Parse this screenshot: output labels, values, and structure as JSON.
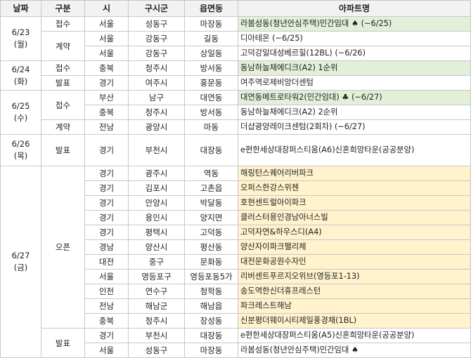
{
  "headers": {
    "date": "날짜",
    "type": "구분",
    "city": "시",
    "district": "구시군",
    "town": "읍면동",
    "apartment": "아파트명"
  },
  "dates": {
    "d0623": {
      "day": "6/23",
      "weekday": "(월)"
    },
    "d0624": {
      "day": "6/24",
      "weekday": "(화)"
    },
    "d0625": {
      "day": "6/25",
      "weekday": "(수)"
    },
    "d0626": {
      "day": "6/26",
      "weekday": "(목)"
    },
    "d0627": {
      "day": "6/27",
      "weekday": "(금)"
    }
  },
  "types": {
    "r0": "접수",
    "r1": "계약",
    "r3": "접수",
    "r4": "발표",
    "r5": "접수",
    "r7": "계약",
    "r8": "발표",
    "r9": "오픈",
    "r20": "발표"
  },
  "rows": [
    {
      "city": "서울",
      "district": "성동구",
      "town": "마장동",
      "apartment": "라봄성동(청년안심주택)민간임대 ♠ (~6/25)",
      "bg": "green"
    },
    {
      "city": "서울",
      "district": "강동구",
      "town": "길동",
      "apartment": "디아테온 (~6/25)",
      "bg": "none"
    },
    {
      "city": "서울",
      "district": "강동구",
      "town": "상일동",
      "apartment": "고덕강일대성베르힐(12BL) (~6/26)",
      "bg": "none"
    },
    {
      "city": "충북",
      "district": "청주시",
      "town": "방서동",
      "apartment": "동남하늘채에디크(A2) 1순위",
      "bg": "green"
    },
    {
      "city": "경기",
      "district": "여주시",
      "town": "홍문동",
      "apartment": "여주역로제비앙더센텀",
      "bg": "none"
    },
    {
      "city": "부산",
      "district": "남구",
      "town": "대연동",
      "apartment": "대연동메트로타워2(민간임대) ♣ (~6/27)",
      "bg": "green"
    },
    {
      "city": "충북",
      "district": "청주시",
      "town": "방서동",
      "apartment": "동남하늘채에디크(A2) 2순위",
      "bg": "none"
    },
    {
      "city": "전남",
      "district": "광양시",
      "town": "마동",
      "apartment": "더샵광양레이크센텀(2회차) (~6/27)",
      "bg": "none"
    },
    {
      "city": "경기",
      "district": "부천시",
      "town": "대장동",
      "apartment": "e편한세상대장퍼스티움(A6)신혼희망타운(공공분양)",
      "bg": "none"
    },
    {
      "city": "경기",
      "district": "광주시",
      "town": "역동",
      "apartment": "해링턴스퀘어리버파크",
      "bg": "yellow"
    },
    {
      "city": "경기",
      "district": "김포시",
      "town": "고촌읍",
      "apartment": "오퍼스한강스위첸",
      "bg": "yellow"
    },
    {
      "city": "경기",
      "district": "안양시",
      "town": "박달동",
      "apartment": "호현센트럴아이파크",
      "bg": "yellow"
    },
    {
      "city": "경기",
      "district": "용인시",
      "town": "양지면",
      "apartment": "클러스터용인경남아너스빌",
      "bg": "yellow"
    },
    {
      "city": "경기",
      "district": "평택시",
      "town": "고덕동",
      "apartment": "고덕자연&하우스디(A4)",
      "bg": "yellow"
    },
    {
      "city": "경남",
      "district": "양산시",
      "town": "평산동",
      "apartment": "양산자이파크팰리체",
      "bg": "yellow"
    },
    {
      "city": "대전",
      "district": "중구",
      "town": "문화동",
      "apartment": "대전문화공원수자인",
      "bg": "yellow"
    },
    {
      "city": "서울",
      "district": "영등포구",
      "town": "영등포동5가",
      "apartment": "리버센트푸르지오위브(영등포1-13)",
      "bg": "yellow"
    },
    {
      "city": "인천",
      "district": "연수구",
      "town": "청학동",
      "apartment": "송도역한신더휴프레스턴",
      "bg": "yellow"
    },
    {
      "city": "전남",
      "district": "해남군",
      "town": "해남읍",
      "apartment": "파크레스트해남",
      "bg": "yellow"
    },
    {
      "city": "충북",
      "district": "청주시",
      "town": "장성동",
      "apartment": "신분평더웨이시티제일풍경채(1BL)",
      "bg": "yellow"
    },
    {
      "city": "경기",
      "district": "부천시",
      "town": "대장동",
      "apartment": "e편한세상대장퍼스티움(A5)신혼희망타운(공공분양)",
      "bg": "none"
    },
    {
      "city": "서울",
      "district": "성동구",
      "town": "마장동",
      "apartment": "라봄성동(청년안심주택)민간임대 ♠",
      "bg": "none"
    }
  ]
}
